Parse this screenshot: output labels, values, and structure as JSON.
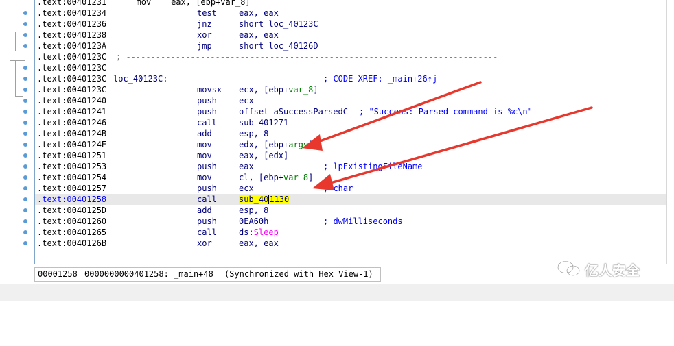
{
  "listing": {
    "partial_top_row": ".text:00401231      mov    eax, [ebp+var_8]",
    "rows": [
      {
        "addr": ".text:00401234",
        "mnem": "test",
        "ops": "eax, eax"
      },
      {
        "addr": ".text:00401236",
        "mnem": "jnz",
        "ops": "short loc_40123C"
      },
      {
        "addr": ".text:00401238",
        "mnem": "xor",
        "ops": "eax, eax"
      },
      {
        "addr": ".text:0040123A",
        "mnem": "jmp",
        "ops": "short loc_40126D"
      },
      {
        "addr": ".text:0040123C",
        "sep": "; ---------------------------------------------------------------------------"
      },
      {
        "addr": ".text:0040123C"
      },
      {
        "addr": ".text:0040123C",
        "label": "loc_40123C:",
        "comment": "; CODE XREF: _main+26↑j"
      },
      {
        "addr": ".text:0040123C",
        "mnem": "movsx",
        "ops_pre": "ecx, [ebp+",
        "ops_var": "var_8",
        "ops_post": "]"
      },
      {
        "addr": ".text:00401240",
        "mnem": "push",
        "ops": "ecx"
      },
      {
        "addr": ".text:00401241",
        "mnem": "push",
        "ops": "offset aSuccessParsedC",
        "comment": "; \"Success: Parsed command is %c\\n\""
      },
      {
        "addr": ".text:00401246",
        "mnem": "call",
        "ops": "sub_401271"
      },
      {
        "addr": ".text:0040124B",
        "mnem": "add",
        "ops": "esp, 8"
      },
      {
        "addr": ".text:0040124E",
        "mnem": "mov",
        "ops_pre": "edx, [ebp+",
        "ops_var": "argv",
        "ops_post": "]"
      },
      {
        "addr": ".text:00401251",
        "mnem": "mov",
        "ops": "eax, [edx]"
      },
      {
        "addr": ".text:00401253",
        "mnem": "push",
        "ops": "eax",
        "comment": "; lpExistingFileName"
      },
      {
        "addr": ".text:00401254",
        "mnem": "mov",
        "ops_pre": "cl, [ebp+",
        "ops_var": "var_8",
        "ops_post": "]"
      },
      {
        "addr": ".text:00401257",
        "mnem": "push",
        "ops": "ecx",
        "comment": "; char"
      },
      {
        "addr": ".text:00401258",
        "mnem": "call",
        "ops_hl_a": "sub_40",
        "ops_hl_b": "1130",
        "highlight": true
      },
      {
        "addr": ".text:0040125D",
        "mnem": "add",
        "ops": "esp, 8"
      },
      {
        "addr": ".text:00401260",
        "mnem": "push",
        "ops": "0EA60h",
        "comment": "; dwMilliseconds"
      },
      {
        "addr": ".text:00401265",
        "mnem": "call",
        "ops_pre": "ds:",
        "ops_api": "Sleep"
      },
      {
        "addr": ".text:0040126B",
        "mnem": "xor",
        "ops": "eax, eax"
      }
    ]
  },
  "statusbar": {
    "offset": "00001258",
    "address": "0000000000401258: _main+48",
    "sync": "(Synchronized with Hex View-1)"
  },
  "watermark": {
    "text": "亿人安全"
  },
  "colors": {
    "arrow": "#e8372c",
    "highlight": "#ffff00",
    "current_line": "#e8e8e8"
  }
}
